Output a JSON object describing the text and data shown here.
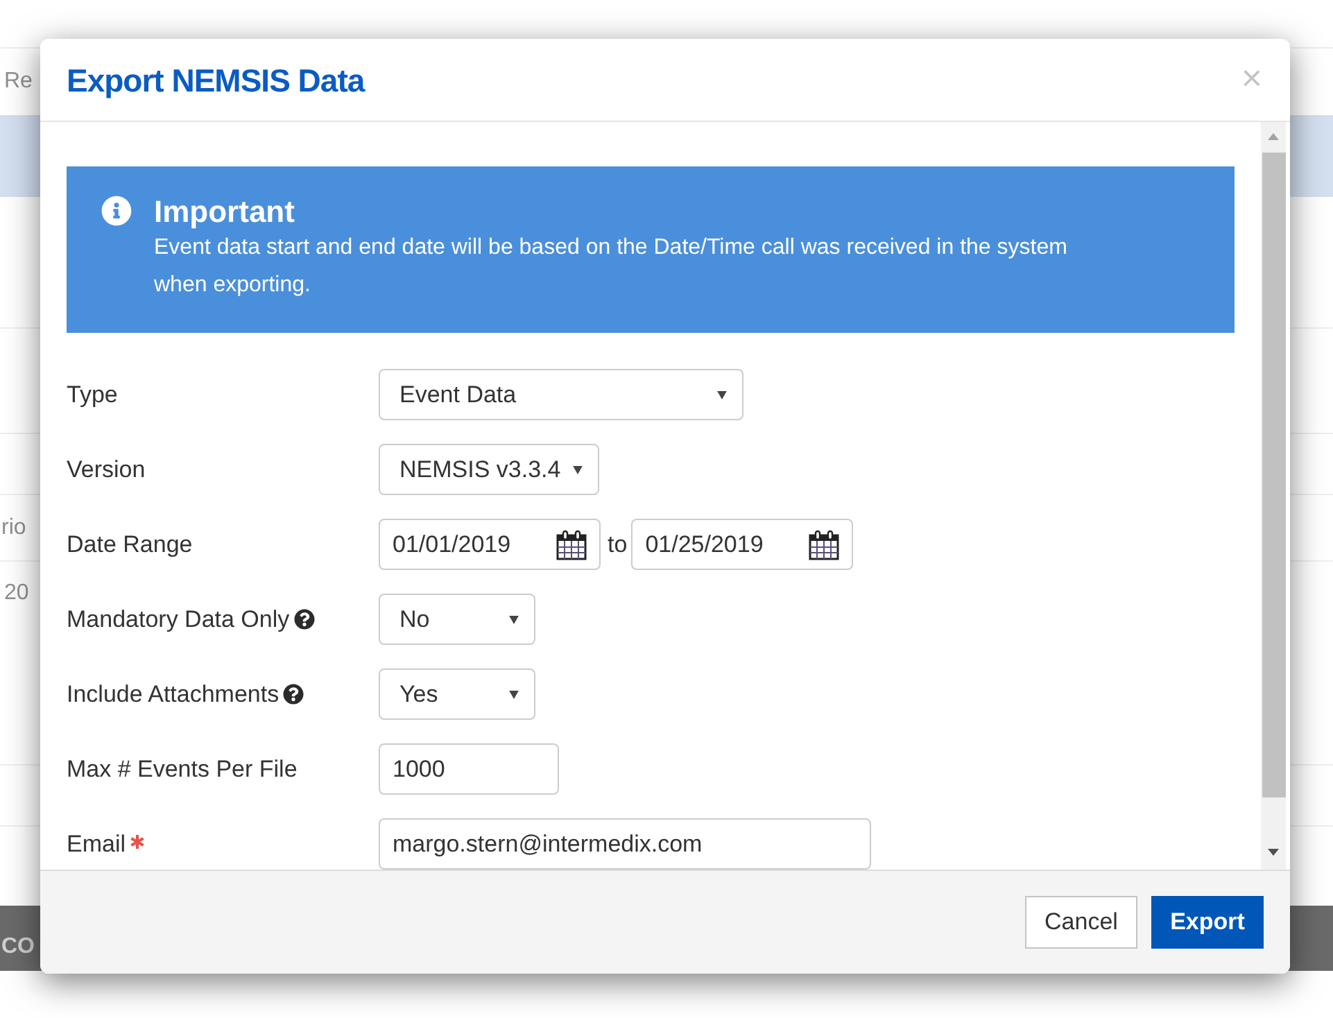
{
  "page_behind": {
    "texts": [
      "Re",
      "rio",
      "20",
      "CO"
    ]
  },
  "dialog": {
    "title": "Export NEMSIS Data",
    "close": "×",
    "notice": {
      "title": "Important",
      "text": "Event data start and end date will be based on the Date/Time call was received in the system when exporting."
    },
    "fields": [
      {
        "label": "Type",
        "kind": "select",
        "value": "Event Data",
        "help": false,
        "required": false
      },
      {
        "label": "Version",
        "kind": "select",
        "value": "NEMSIS v3.3.4",
        "help": false,
        "required": false
      },
      {
        "label": "Date Range",
        "kind": "date_range",
        "from": "01/01/2019",
        "joiner": "to",
        "to": "01/25/2019",
        "help": false,
        "required": false
      },
      {
        "label": "Mandatory Data Only",
        "kind": "select",
        "value": "No",
        "help": true,
        "required": false
      },
      {
        "label": "Include Attachments",
        "kind": "select",
        "value": "Yes",
        "help": true,
        "required": false
      },
      {
        "label": "Max # Events Per File",
        "kind": "text",
        "value": "1000",
        "help": false,
        "required": false
      },
      {
        "label": "Email",
        "kind": "text",
        "value": "margo.stern@intermedix.com",
        "help": false,
        "required": true
      }
    ],
    "buttons": [
      {
        "label": "Cancel",
        "kind": "secondary"
      },
      {
        "label": "Export",
        "kind": "primary"
      }
    ]
  }
}
